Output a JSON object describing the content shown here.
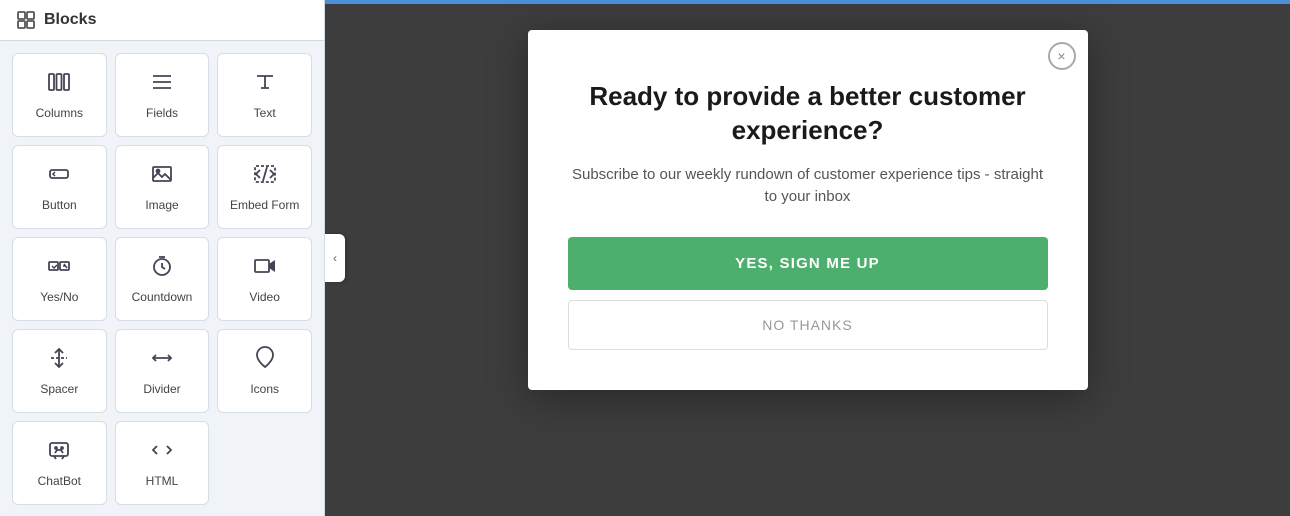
{
  "sidebar": {
    "title": "Blocks",
    "blocks": [
      {
        "id": "columns",
        "label": "Columns",
        "icon": "⊞"
      },
      {
        "id": "fields",
        "label": "Fields",
        "icon": "☰"
      },
      {
        "id": "text",
        "label": "Text",
        "icon": "¶"
      },
      {
        "id": "button",
        "label": "Button",
        "icon": "⬛"
      },
      {
        "id": "image",
        "label": "Image",
        "icon": "🖼"
      },
      {
        "id": "embed-form",
        "label": "Embed Form",
        "icon": "</>"
      },
      {
        "id": "yes-no",
        "label": "Yes/No",
        "icon": "⇌"
      },
      {
        "id": "countdown",
        "label": "Countdown",
        "icon": "⏰"
      },
      {
        "id": "video",
        "label": "Video",
        "icon": "🎥"
      },
      {
        "id": "spacer",
        "label": "Spacer",
        "icon": "⇕"
      },
      {
        "id": "divider",
        "label": "Divider",
        "icon": "⟼"
      },
      {
        "id": "icons",
        "label": "Icons",
        "icon": "♡"
      },
      {
        "id": "chatbot",
        "label": "ChatBot",
        "icon": "💬"
      },
      {
        "id": "html",
        "label": "HTML",
        "icon": "</>"
      }
    ]
  },
  "modal": {
    "title": "Ready to provide a better customer experience?",
    "subtitle": "Subscribe to our weekly rundown of customer experience tips - straight to your inbox",
    "btn_yes": "YES, SIGN ME UP",
    "btn_no": "NO THANKS",
    "close_label": "×"
  },
  "collapse_icon": "‹"
}
